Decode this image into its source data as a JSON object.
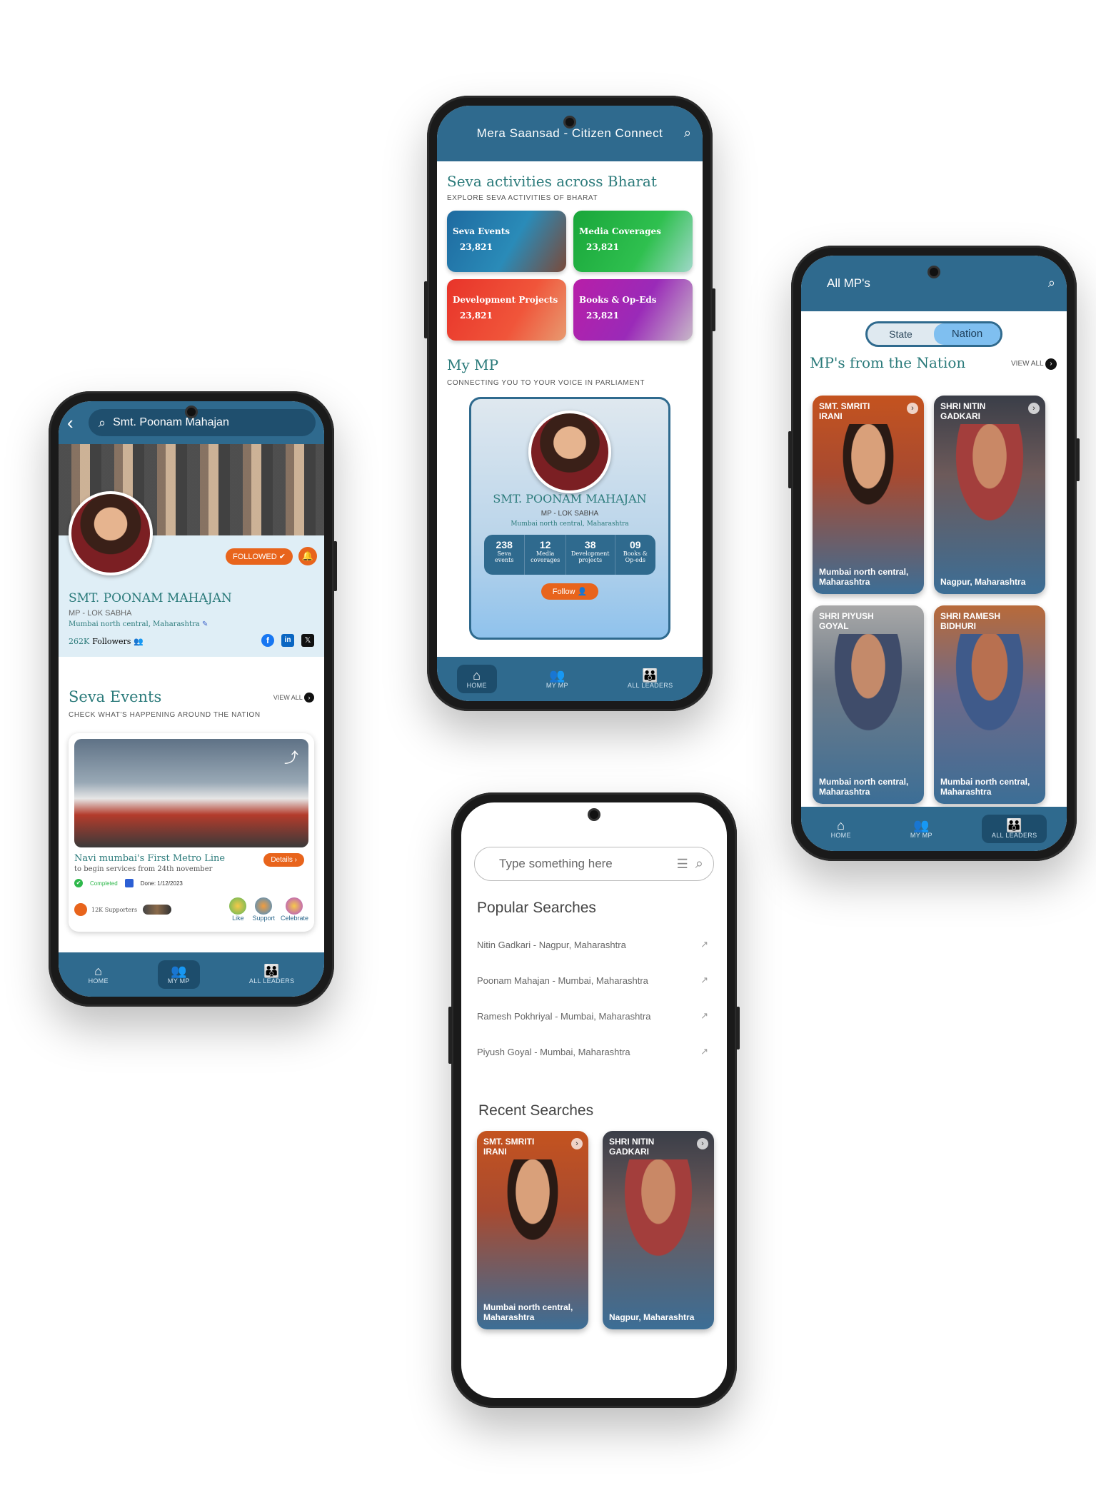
{
  "phone_profile": {
    "search_value": "Smt. Poonam Mahajan",
    "followed_label": "FOLLOWED",
    "name": "SMT. POONAM MAHAJAN",
    "role": "MP - LOK SABHA",
    "constituency": "Mumbai north central, Maharashtra",
    "followers_count": "262K",
    "followers_label": "Followers",
    "section_title": "Seva Events",
    "section_view_all": "VIEW ALL",
    "section_subtitle": "CHECK WHAT'S HAPPENING AROUND THE NATION",
    "event": {
      "title": "Navi mumbai's First Metro Line",
      "desc": "to begin services from 24th november",
      "details_label": "Details",
      "status": "Completed",
      "date": "Done: 1/12/2023",
      "supporters": "12K Supporters",
      "actions": [
        "Like",
        "Support",
        "Celebrate"
      ]
    },
    "nav": [
      "HOME",
      "MY MP",
      "ALL LEADERS"
    ]
  },
  "phone_home": {
    "app_title": "Mera Saansad - Citizen Connect",
    "section1_title": "Seva activities across Bharat",
    "section1_subtitle": "EXPLORE SEVA ACTIVITIES OF BHARAT",
    "tiles": [
      {
        "label": "Seva Events",
        "count": "23,821"
      },
      {
        "label": "Media Coverages",
        "count": "23,821"
      },
      {
        "label": "Development Projects",
        "count": "23,821"
      },
      {
        "label": "Books & Op-Eds",
        "count": "23,821"
      }
    ],
    "section2_title": "My MP",
    "section2_subtitle": "CONNECTING YOU TO YOUR VOICE IN PARLIAMENT",
    "mp": {
      "name": "SMT. POONAM MAHAJAN",
      "role": "MP - LOK SABHA",
      "constituency": "Mumbai north central, Maharashtra",
      "stats": [
        {
          "value": "238",
          "label": "Seva events"
        },
        {
          "value": "12",
          "label": "Media coverages"
        },
        {
          "value": "38",
          "label": "Development projects"
        },
        {
          "value": "09",
          "label": "Books & Op-eds"
        }
      ],
      "follow_label": "Follow"
    },
    "nav": [
      "HOME",
      "MY MP",
      "ALL LEADERS"
    ]
  },
  "phone_all_mps": {
    "title": "All MP's",
    "toggle": [
      "State",
      "Nation"
    ],
    "section_title": "MP's from the Nation",
    "view_all": "VIEW ALL",
    "cards": [
      {
        "name": "SMT. SMRITI IRANI",
        "location": "Mumbai north central, Maharashtra"
      },
      {
        "name": "SHRI NITIN GADKARI",
        "location": "Nagpur, Maharashtra"
      },
      {
        "name": "SHRI PIYUSH GOYAL",
        "location": "Mumbai north central, Maharashtra"
      },
      {
        "name": "SHRI RAMESH BIDHURI",
        "location": "Mumbai north central, Maharashtra"
      }
    ],
    "nav": [
      "HOME",
      "MY MP",
      "ALL LEADERS"
    ]
  },
  "phone_search": {
    "placeholder": "Type something here",
    "popular_title": "Popular Searches",
    "popular": [
      "Nitin Gadkari - Nagpur, Maharashtra",
      "Poonam Mahajan - Mumbai, Maharashtra",
      "Ramesh Pokhriyal - Mumbai, Maharashtra",
      "Piyush Goyal - Mumbai, Maharashtra"
    ],
    "recent_title": "Recent Searches",
    "recent": [
      {
        "name": "SMT. SMRITI IRANI",
        "location": "Mumbai north central, Maharashtra"
      },
      {
        "name": "SHRI NITIN GADKARI",
        "location": "Nagpur, Maharashtra"
      }
    ]
  },
  "colors": {
    "primary": "#2f6a8e",
    "accent": "#e8641c",
    "teal_text": "#2a7a7a"
  }
}
